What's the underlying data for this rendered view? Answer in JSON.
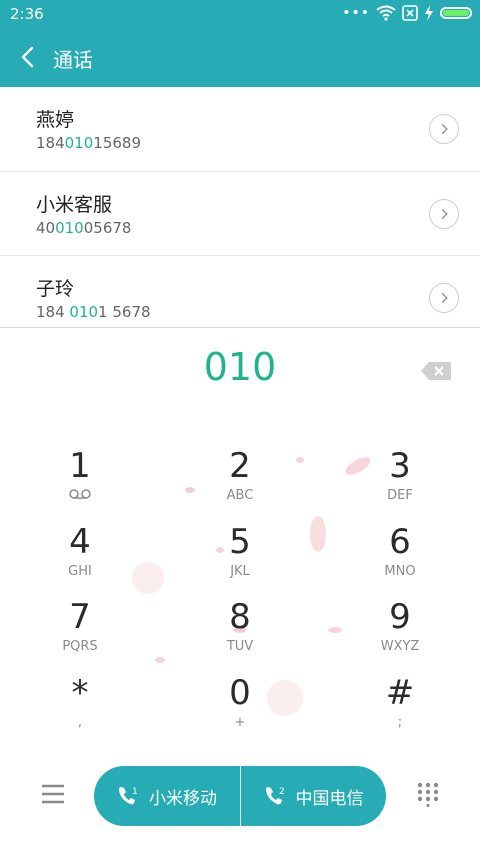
{
  "status": {
    "time": "2:36"
  },
  "header": {
    "title": "通话"
  },
  "results": [
    {
      "name": "燕婷",
      "number_pre": "184",
      "number_hl": "010",
      "number_post": "15689"
    },
    {
      "name": "小米客服",
      "number_pre": "40",
      "number_hl": "010",
      "number_post": "05678"
    },
    {
      "name": "子玲",
      "number_pre": "184 ",
      "number_hl": "010",
      "number_post": "1 5678"
    }
  ],
  "dialer": {
    "digits": "010"
  },
  "keys": [
    {
      "num": "1",
      "sub": ""
    },
    {
      "num": "2",
      "sub": "ABC"
    },
    {
      "num": "3",
      "sub": "DEF"
    },
    {
      "num": "4",
      "sub": "GHI"
    },
    {
      "num": "5",
      "sub": "JKL"
    },
    {
      "num": "6",
      "sub": "MNO"
    },
    {
      "num": "7",
      "sub": "PQRS"
    },
    {
      "num": "8",
      "sub": "TUV"
    },
    {
      "num": "9",
      "sub": "WXYZ"
    },
    {
      "num": "*",
      "sub": ","
    },
    {
      "num": "0",
      "sub": "+"
    },
    {
      "num": "#",
      "sub": ";"
    }
  ],
  "call_buttons": [
    {
      "sim": "1",
      "carrier": "小米移动"
    },
    {
      "sim": "2",
      "carrier": "中国电信"
    }
  ],
  "colors": {
    "accent": "#27acb6",
    "highlight": "#21b48c",
    "battery": "#6cf06a"
  },
  "icons": [
    "back-icon",
    "chevron-right-icon",
    "backspace-icon",
    "voicemail-icon",
    "menu-icon",
    "phone-icon",
    "keypad-icon",
    "wifi-icon",
    "sim-x-icon",
    "charging-icon",
    "battery-icon"
  ]
}
